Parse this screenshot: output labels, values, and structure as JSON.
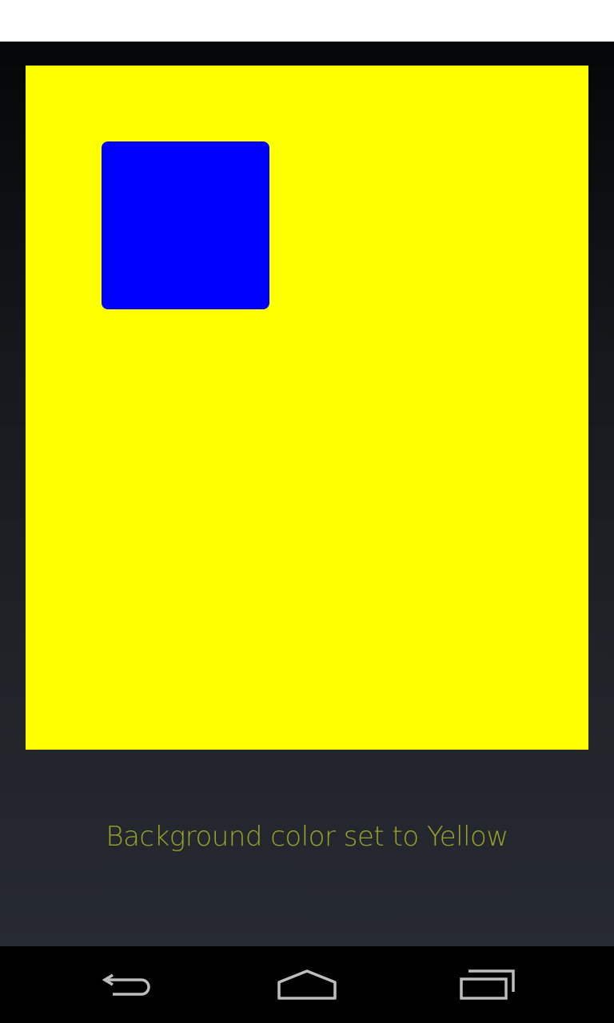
{
  "canvas": {
    "background_color": "#ffff00",
    "square_color": "#0000ff"
  },
  "message": {
    "text": "Background color set to Yellow",
    "color": "#9aa32a"
  },
  "nav": {
    "buttons": [
      {
        "name": "back-icon"
      },
      {
        "name": "home-icon"
      },
      {
        "name": "recent-apps-icon"
      }
    ]
  }
}
